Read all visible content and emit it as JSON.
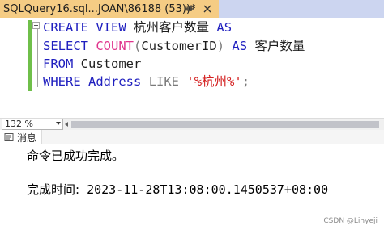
{
  "tab": {
    "title": "SQLQuery16.sql...JOAN\\86188 (53))*",
    "pin_icon": "pin-icon",
    "close_icon": "close-icon"
  },
  "editor": {
    "line1": {
      "kw1": "CREATE VIEW",
      "name": "杭州客户数量",
      "kw2": "AS"
    },
    "line2": {
      "kw1": "SELECT",
      "fn": "COUNT",
      "open": "(",
      "col": "CustomerID",
      "close": ")",
      "kw2": "AS",
      "alias": "客户数量"
    },
    "line3": {
      "kw1": "FROM",
      "table": "Customer"
    },
    "line4": {
      "kw1": "WHERE",
      "col": "Address",
      "kw2": "LIKE",
      "str": "'%杭州%'",
      "semi": ";"
    }
  },
  "zoom": {
    "value": "132 %"
  },
  "results": {
    "tab_label": "消息",
    "tab_icon": "message-icon",
    "line1": "命令已成功完成。",
    "line2_label": "完成时间:",
    "line2_value": "2023-11-28T13:08:00.1450537+08:00"
  },
  "watermark": "CSDN @Linyeji"
}
